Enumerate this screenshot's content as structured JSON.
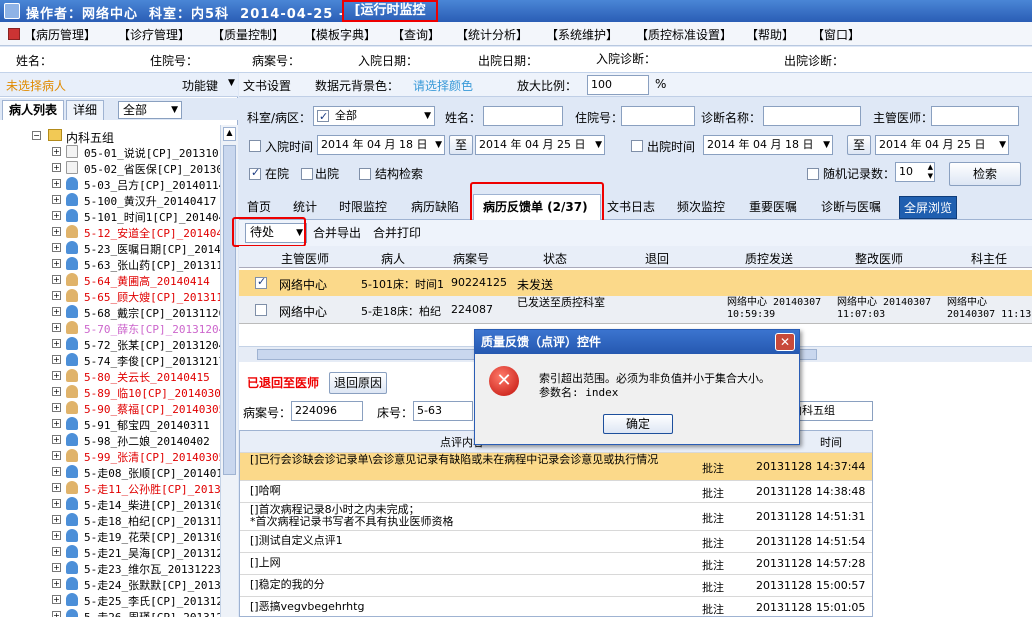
{
  "titlebar": {
    "text": "操作者：网络中心  科室：内5科  2014-04-25 -",
    "mode": "[运行时监控"
  },
  "menu": [
    "【病历管理】",
    "【诊疗管理】",
    "【质量控制】",
    "【模板字典】",
    "【查询】",
    "【统计分析】",
    "【系统维护】",
    "【质控标准设置】",
    "【帮助】",
    "【窗口】"
  ],
  "infobar": {
    "name": "姓名：",
    "bed": "住院号：",
    "case": "病案号：",
    "admit": "入院日期：",
    "discharge": "出院日期：",
    "admit_diag": "入院诊断：",
    "discharge_diag": "出院诊断："
  },
  "leftpanel": {
    "no_patient": "未选择病人",
    "func_key": "功能键",
    "tab_list": "病人列表",
    "tab_detail": "详细",
    "filter_value": "全部",
    "root": "内科五组",
    "patients": [
      {
        "label": "05-01_说说[CP]_2013101",
        "color": "#000",
        "icon": "d"
      },
      {
        "label": "05-02_省医保[CP]_20130",
        "color": "#000",
        "icon": "d"
      },
      {
        "label": "5-03_吕方[CP]_20140114",
        "color": "#000",
        "icon": "b"
      },
      {
        "label": "5-100_黄汉升_20140417",
        "color": "#000",
        "icon": "b"
      },
      {
        "label": "5-101_时间1[CP]_201404",
        "color": "#000",
        "icon": "b"
      },
      {
        "label": "5-12_安道全[CP]_201404",
        "color": "#e00000",
        "icon": "p"
      },
      {
        "label": "5-23_医嘱日期[CP]_2014",
        "color": "#000",
        "icon": "b"
      },
      {
        "label": "5-63_张山药[CP]_201311",
        "color": "#000",
        "icon": "b"
      },
      {
        "label": "5-64_黄圃高_20140414",
        "color": "#e00000",
        "icon": "p"
      },
      {
        "label": "5-65_顾大嫂[CP]_201311",
        "color": "#e00000",
        "icon": "p"
      },
      {
        "label": "5-68_戴宗[CP]_20131120",
        "color": "#000",
        "icon": "b"
      },
      {
        "label": "5-70_薛东[CP]_20131204",
        "color": "#cc66cc",
        "icon": "p"
      },
      {
        "label": "5-72_张某[CP]_20131204",
        "color": "#000",
        "icon": "b"
      },
      {
        "label": "5-74_李俊[CP]_20131217",
        "color": "#000",
        "icon": "b"
      },
      {
        "label": "5-80_关云长_20140415",
        "color": "#e00000",
        "icon": "p"
      },
      {
        "label": "5-89_临10[CP]_20140304",
        "color": "#e00000",
        "icon": "p"
      },
      {
        "label": "5-90_蔡福[CP]_20140305",
        "color": "#e00000",
        "icon": "p"
      },
      {
        "label": "5-91_郁宝四_20140311",
        "color": "#000",
        "icon": "b"
      },
      {
        "label": "5-98_孙二娘_20140402",
        "color": "#000",
        "icon": "b"
      },
      {
        "label": "5-99_张清[CP]_20140305",
        "color": "#e00000",
        "icon": "p"
      },
      {
        "label": "5-走08_张顺[CP]_201401",
        "color": "#000",
        "icon": "b"
      },
      {
        "label": "5-走11_公孙胜[CP]_2013",
        "color": "#e00000",
        "icon": "p"
      },
      {
        "label": "5-走14_柴进[CP]_201310",
        "color": "#000",
        "icon": "b"
      },
      {
        "label": "5-走18_柏纪[CP]_201311",
        "color": "#000",
        "icon": "b"
      },
      {
        "label": "5-走19_花荣[CP]_201310",
        "color": "#000",
        "icon": "b"
      },
      {
        "label": "5-走21_吴海[CP]_201312",
        "color": "#000",
        "icon": "b"
      },
      {
        "label": "5-走23_维尔瓦_20131223",
        "color": "#000",
        "icon": "b"
      },
      {
        "label": "5-走24_张默默[CP]_2013",
        "color": "#000",
        "icon": "b"
      },
      {
        "label": "5-走25_李氏[CP]_201312",
        "color": "#000",
        "icon": "b"
      },
      {
        "label": "5-走26_周瑾[CP]_201312",
        "color": "#000",
        "icon": "b"
      }
    ]
  },
  "toolrow": {
    "doc_settings": "文书设置",
    "bg_color_label": "数据元背景色：",
    "bg_color_value": "请选择颜色",
    "zoom_label": "放大比例：",
    "zoom_value": "100",
    "zoom_unit": "%"
  },
  "filter": {
    "dept_label": "科室/病区：",
    "dept_value": "全部",
    "name_label": "姓名：",
    "bed_label": "住院号：",
    "diag_label": "诊断名称：",
    "doctor_label": "主管医师：",
    "admit_time": "入院时间",
    "admit_from": "2014 年 04 月 18 日",
    "to1": "至",
    "admit_to": "2014 年 04 月 25 日",
    "discharge_time": "出院时间",
    "dis_from": "2014 年 04 月 18 日",
    "to2": "至",
    "dis_to": "2014 年 04 月 25 日",
    "in_hosp": "在院",
    "out_hosp": "出院",
    "struct_search": "结构检索",
    "random_label": "随机记录数：",
    "random_value": "10",
    "search_btn": "检索"
  },
  "navtabs": [
    "首页",
    "统计",
    "时限监控",
    "病历缺陷",
    "病历反馈单 (2/37)",
    "文书日志",
    "频次监控",
    "重要医嘱",
    "诊断与医嘱",
    "全屏浏览"
  ],
  "actions": {
    "status": "待处",
    "merge_export": "合并导出",
    "merge_print": "合并打印"
  },
  "grid1": {
    "headers": [
      "主管医师",
      "病人",
      "病案号",
      "状态",
      "退回",
      "质控发送",
      "整改医师",
      "科主任"
    ],
    "rows": [
      {
        "doctor": "网络中心",
        "patient": "5-101床：时间1",
        "case": "90224125",
        "status": "未发送",
        "qc_send": "",
        "fix": "",
        "dir": ""
      },
      {
        "doctor": "网络中心",
        "patient": "5-走18床：柏纪",
        "case": "224087",
        "status": "已发送至质控科室",
        "qc_send": "网络中心 20140307 10:59:39",
        "fix": "网络中心 20140307 11:07:03",
        "dir": "网络中心 20140307 11:13"
      }
    ]
  },
  "lower": {
    "returned_label": "已退回至医师",
    "return_reason_btn": "退回原因",
    "case_label": "病案号：",
    "case_value": "224096",
    "bed_label": "床号：",
    "bed_value": "5-63",
    "group_value": "内科五组"
  },
  "grid2": {
    "headers": [
      "点评内容",
      "",
      "",
      "时间"
    ],
    "rows": [
      {
        "text": "[]已行会诊缺会诊记录单\\会诊意见记录有缺陷或未在病程中记录会诊意见或执行情况",
        "type": "批注",
        "date": "20131128",
        "time": "14:37:44"
      },
      {
        "text": "[]哈啊",
        "type": "批注",
        "date": "20131128",
        "time": "14:38:48"
      },
      {
        "text": "[]首次病程记录8小时之内未完成；\n*首次病程记录书写者不具有执业医师资格",
        "type": "批注",
        "date": "20131128",
        "time": "14:51:31"
      },
      {
        "text": "[]测试自定义点评1",
        "type": "批注",
        "date": "20131128",
        "time": "14:51:54"
      },
      {
        "text": "[]上网",
        "type": "批注",
        "date": "20131128",
        "time": "14:57:28"
      },
      {
        "text": "[]稳定的我的分",
        "type": "批注",
        "date": "20131128",
        "time": "15:00:57"
      },
      {
        "text": "[]恶搞vegvbegehrhtg",
        "type": "批注",
        "date": "20131128",
        "time": "15:01:05"
      }
    ]
  },
  "dialog": {
    "title": "质量反馈（点评）控件",
    "message": "索引超出范围。必须为非负值并小于集合大小。",
    "param": "参数名: index",
    "ok": "确定"
  }
}
